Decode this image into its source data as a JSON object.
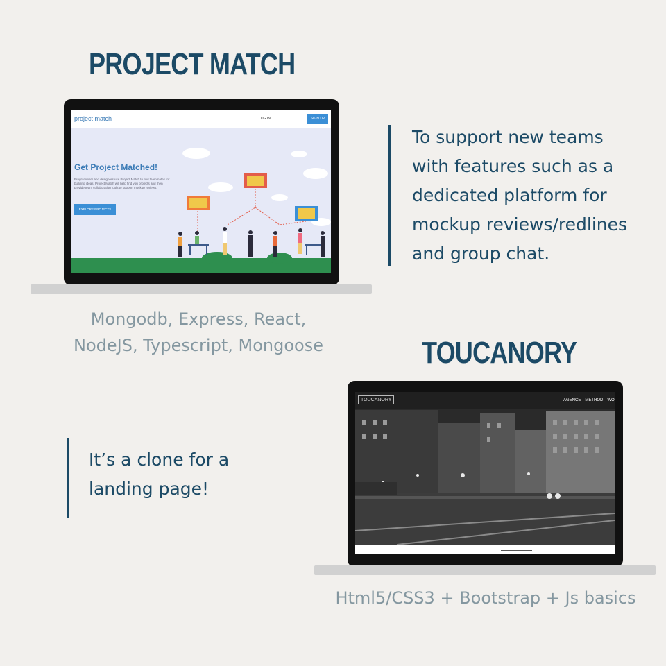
{
  "project1": {
    "title": "PROJECT MATCH",
    "description": "To support new teams with features such as a dedicated platform for mockup reviews/redlines and group chat.",
    "tech_line1": "Mongodb, Express, React,",
    "tech_line2": "NodeJS, Typescript, Mongoose",
    "screen": {
      "logo": "project match",
      "login": "LOG IN",
      "signup": "SIGN UP",
      "hero_title": "Get Project Matched!",
      "hero_body": "Programmers and designers use Project Match to find teammates for building ideas. Project Match will help find you projects and then provide team collaboration tools to support mockup reviews.",
      "cta": "EXPLORE PROJECTS"
    }
  },
  "project2": {
    "title": "TOUCANORY",
    "description": "It’s a clone for a landing page!",
    "tech": "Html5/CSS3 + Bootstrap + Js basics",
    "screen": {
      "logo": "TOUCANORY",
      "menu": [
        "AGENCE",
        "METHOD",
        "WO"
      ]
    }
  }
}
